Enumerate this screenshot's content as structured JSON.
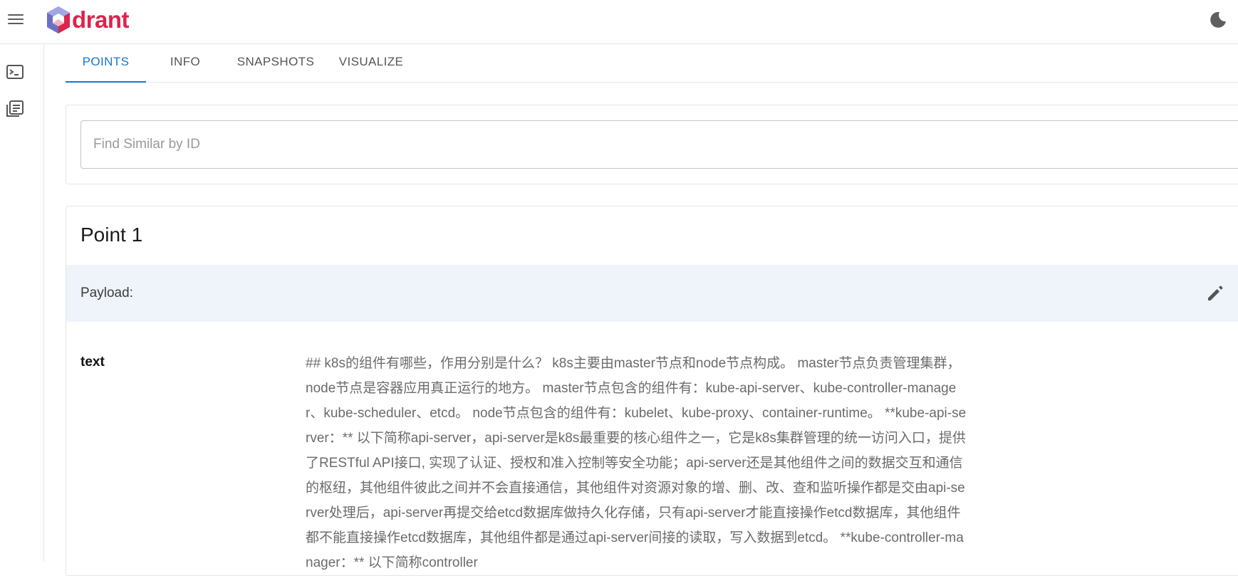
{
  "app": {
    "logo_text": "drant",
    "brand_color": "#dc244c",
    "accent_color": "#1976d2"
  },
  "header": {
    "menu_icon": "hamburger-menu-icon",
    "theme_icon": "moon-icon"
  },
  "sidebar": {
    "items": [
      {
        "icon": "terminal-console-icon"
      },
      {
        "icon": "collections-library-icon"
      }
    ]
  },
  "tabs": [
    {
      "label": "POINTS",
      "active": true
    },
    {
      "label": "INFO",
      "active": false
    },
    {
      "label": "SNAPSHOTS",
      "active": false
    },
    {
      "label": "VISUALIZE",
      "active": false
    }
  ],
  "search": {
    "placeholder": "Find Similar by ID",
    "value": ""
  },
  "point": {
    "title": "Point 1",
    "payload_label": "Payload:",
    "edit_icon": "pencil-icon",
    "fields": [
      {
        "key": "text",
        "value": "## k8s的组件有哪些，作用分别是什么？ k8s主要由master节点和node节点构成。 master节点负责管理集群，node节点是容器应用真正运行的地方。 master节点包含的组件有：kube-api-server、kube-controller-manager、kube-scheduler、etcd。 node节点包含的组件有：kubelet、kube-proxy、container-runtime。 **kube-api-server：** 以下简称api-server，api-server是k8s最重要的核心组件之一，它是k8s集群管理的统一访问入口，提供了RESTful API接口, 实现了认证、授权和准入控制等安全功能；api-server还是其他组件之间的数据交互和通信的枢纽，其他组件彼此之间并不会直接通信，其他组件对资源对象的增、删、改、查和监听操作都是交由api-server处理后，api-server再提交给etcd数据库做持久化存储，只有api-server才能直接操作etcd数据库，其他组件都不能直接操作etcd数据库，其他组件都是通过api-server间接的读取，写入数据到etcd。 **kube-controller-manager：** 以下简称controller"
      }
    ]
  }
}
